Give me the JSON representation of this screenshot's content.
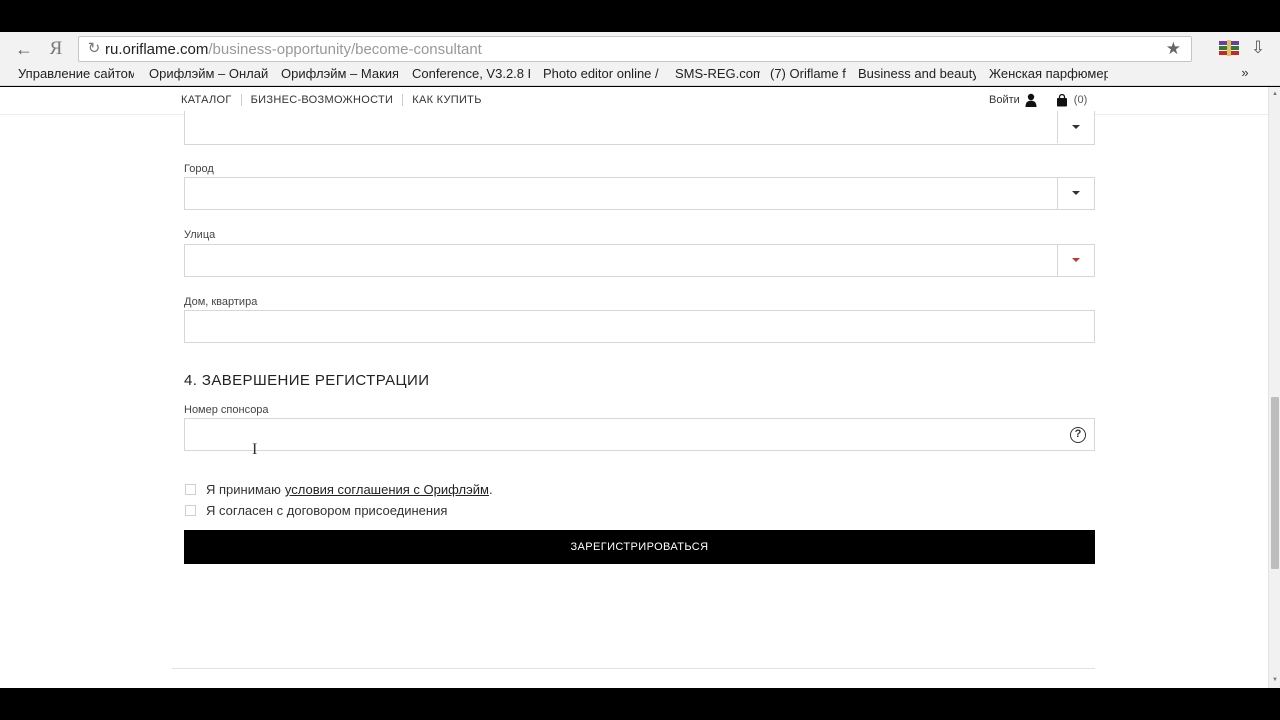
{
  "browser": {
    "url_host": "ru.oriflame.com",
    "url_path": "/business-opportunity/become-consultant",
    "bookmarks": [
      "Управление сайтом",
      "Орифлэйм – Онлайн",
      "Орифлэйм – Макия",
      "Conference, V3.2.8 H",
      "Photo editor online /",
      "SMS-REG.com",
      "(7) Oriflame f",
      "Business and beauty",
      "Женская парфюмер"
    ],
    "more_bookmarks": "»"
  },
  "site_header": {
    "nav": [
      "КАТАЛОГ",
      "БИЗНЕС-ВОЗМОЖНОСТИ",
      "КАК КУПИТЬ"
    ],
    "login": "Войти",
    "cart_count": "(0)"
  },
  "form": {
    "city_label": "Город",
    "street_label": "Улица",
    "house_label": "Дом, квартира",
    "section_title": "4. ЗАВЕРШЕНИЕ РЕГИСТРАЦИИ",
    "sponsor_label": "Номер спонсора",
    "help_glyph": "?",
    "accept_prefix": "Я принимаю",
    "accept_link": "условия соглашения с Орифлэйм",
    "accept_suffix": ".",
    "agree_label": "Я согласен с договором присоединения",
    "submit_label": "ЗАРЕГИСТРИРОВАТЬСЯ"
  }
}
